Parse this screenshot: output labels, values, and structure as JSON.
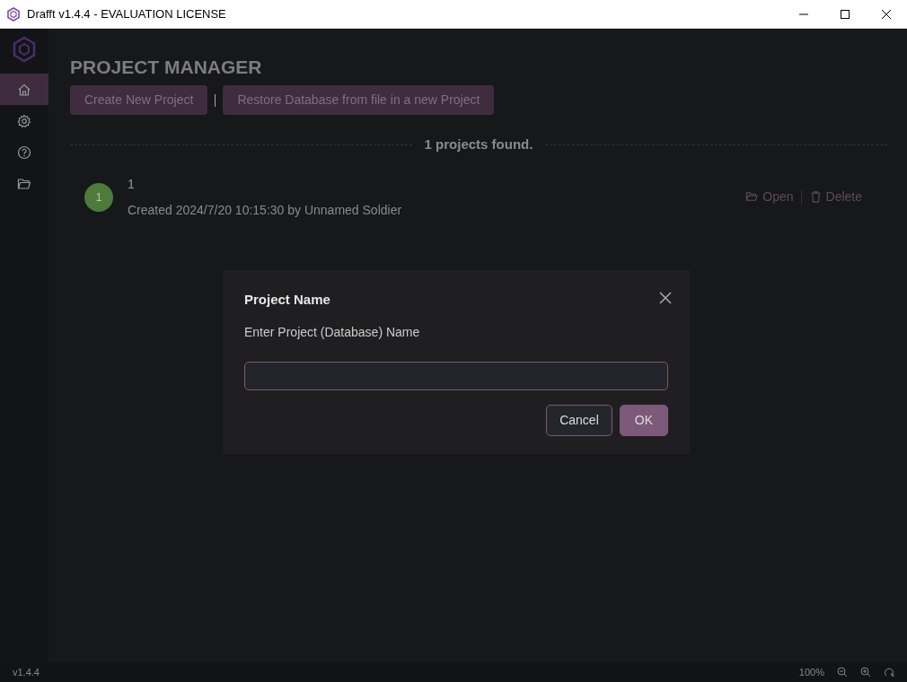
{
  "window": {
    "title": "Drafft v1.4.4 - EVALUATION LICENSE"
  },
  "sidebar": {
    "items": [
      {
        "kind": "home",
        "selected": true
      },
      {
        "kind": "settings",
        "selected": false
      },
      {
        "kind": "help",
        "selected": false
      },
      {
        "kind": "folder",
        "selected": false
      }
    ]
  },
  "page": {
    "title": "PROJECT MANAGER",
    "buttons": [
      "Create New Project",
      "Restore Database from file in a new Project"
    ],
    "status": "1 projects found.",
    "projects": [
      {
        "badge": "1",
        "name": "1",
        "meta": "Created 2024/7/20 10:15:30 by Unnamed Soldier",
        "actions": [
          {
            "kind": "open",
            "label": "Open"
          },
          {
            "kind": "delete",
            "label": "Delete"
          }
        ]
      }
    ]
  },
  "dialog": {
    "title": "Project Name",
    "label": "Enter Project (Database) Name",
    "buttons": [
      {
        "kind": "secondary",
        "label": "Cancel"
      },
      {
        "kind": "primary",
        "label": "OK"
      }
    ]
  },
  "status_bar": {
    "version": "v1.4.4",
    "zoom": "100%"
  }
}
